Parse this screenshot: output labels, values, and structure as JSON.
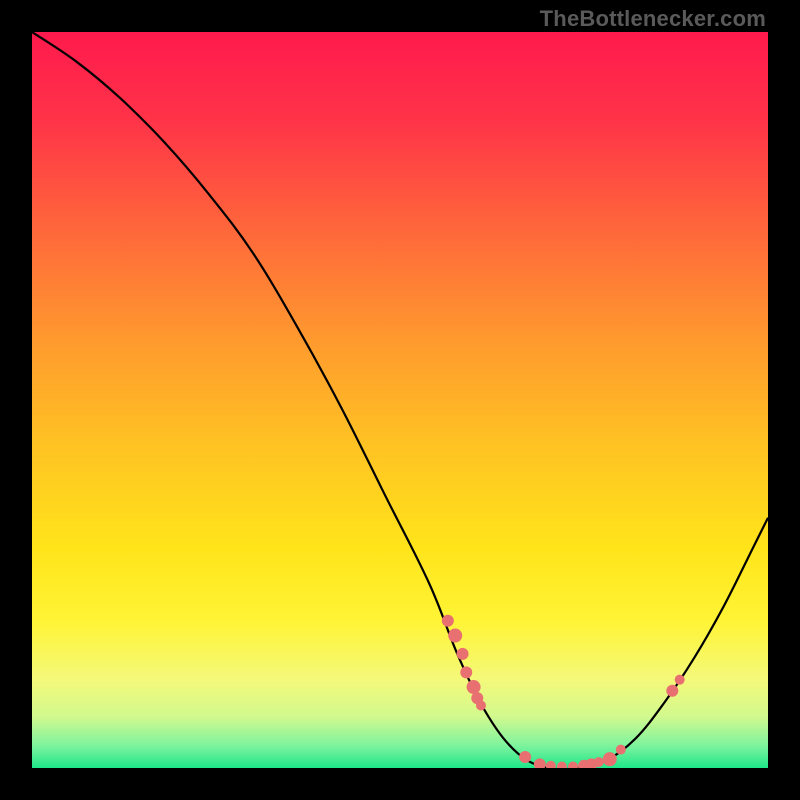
{
  "attribution": "TheBottlenecker.com",
  "chart_data": {
    "type": "line",
    "title": "",
    "xlabel": "",
    "ylabel": "",
    "xlim": [
      0,
      100
    ],
    "ylim": [
      0,
      100
    ],
    "grid": false,
    "curve": [
      {
        "x": 0,
        "y": 100
      },
      {
        "x": 6,
        "y": 96
      },
      {
        "x": 12,
        "y": 91
      },
      {
        "x": 18,
        "y": 85
      },
      {
        "x": 24,
        "y": 78
      },
      {
        "x": 30,
        "y": 70
      },
      {
        "x": 36,
        "y": 60
      },
      {
        "x": 42,
        "y": 49
      },
      {
        "x": 48,
        "y": 37
      },
      {
        "x": 54,
        "y": 25
      },
      {
        "x": 58,
        "y": 15
      },
      {
        "x": 62,
        "y": 7
      },
      {
        "x": 66,
        "y": 2
      },
      {
        "x": 70,
        "y": 0
      },
      {
        "x": 74,
        "y": 0
      },
      {
        "x": 78,
        "y": 1
      },
      {
        "x": 82,
        "y": 4
      },
      {
        "x": 86,
        "y": 9
      },
      {
        "x": 90,
        "y": 15
      },
      {
        "x": 94,
        "y": 22
      },
      {
        "x": 98,
        "y": 30
      },
      {
        "x": 100,
        "y": 34
      }
    ],
    "markers": [
      {
        "x": 56.5,
        "y": 20,
        "r": 6
      },
      {
        "x": 57.5,
        "y": 18,
        "r": 7
      },
      {
        "x": 58.5,
        "y": 15.5,
        "r": 6
      },
      {
        "x": 59,
        "y": 13,
        "r": 6
      },
      {
        "x": 60,
        "y": 11,
        "r": 7
      },
      {
        "x": 60.5,
        "y": 9.5,
        "r": 6
      },
      {
        "x": 61,
        "y": 8.5,
        "r": 5
      },
      {
        "x": 67,
        "y": 1.5,
        "r": 6
      },
      {
        "x": 69,
        "y": 0.5,
        "r": 6
      },
      {
        "x": 70.5,
        "y": 0.3,
        "r": 5
      },
      {
        "x": 72,
        "y": 0.2,
        "r": 5
      },
      {
        "x": 73.5,
        "y": 0.2,
        "r": 5
      },
      {
        "x": 75,
        "y": 0.3,
        "r": 6
      },
      {
        "x": 76,
        "y": 0.5,
        "r": 6
      },
      {
        "x": 77,
        "y": 0.8,
        "r": 5
      },
      {
        "x": 78.5,
        "y": 1.2,
        "r": 7
      },
      {
        "x": 80,
        "y": 2.5,
        "r": 5
      },
      {
        "x": 87,
        "y": 10.5,
        "r": 6
      },
      {
        "x": 88,
        "y": 12,
        "r": 5
      }
    ],
    "gradient_stops": [
      {
        "offset": 0.0,
        "color": "#ff1a4d"
      },
      {
        "offset": 0.12,
        "color": "#ff3348"
      },
      {
        "offset": 0.28,
        "color": "#ff6b3a"
      },
      {
        "offset": 0.42,
        "color": "#ff9a2e"
      },
      {
        "offset": 0.56,
        "color": "#ffc223"
      },
      {
        "offset": 0.7,
        "color": "#ffe41a"
      },
      {
        "offset": 0.8,
        "color": "#fff435"
      },
      {
        "offset": 0.88,
        "color": "#f4f97a"
      },
      {
        "offset": 0.93,
        "color": "#d2f98e"
      },
      {
        "offset": 0.97,
        "color": "#7df39e"
      },
      {
        "offset": 1.0,
        "color": "#1fe68a"
      }
    ],
    "marker_color": "#e97070",
    "curve_color": "#000000"
  }
}
